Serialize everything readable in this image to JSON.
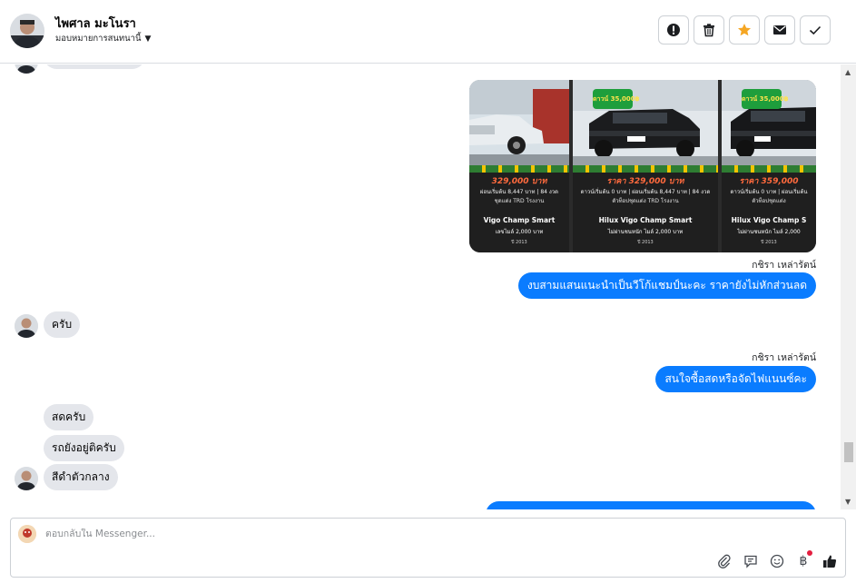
{
  "header": {
    "contact_name": "ไพศาล มะโนรา",
    "assign_label": "มอบหมายการสนทนานี้"
  },
  "messages": {
    "out_1": "งบสามแสนแนะนำเป็นวีโก้แชมป์นะคะ ราคายังไม่หักส่วนลด",
    "in_1": "ครับ",
    "out_2": "สนใจซื้อสดหรือจัดไฟแนนซ์คะ",
    "in_2": "สดครับ",
    "in_3": "รถยังอยู่ติครับ",
    "in_4": "สีดำตัวกลาง",
    "sender_1": "กชิรา เหล่ารัตน์",
    "sender_2": "กชิรา เหล่ารัตน์"
  },
  "attachment": {
    "cards": [
      {
        "badge": "",
        "price": "329,000 บาท",
        "detail": "ผ่อนเริ่มต้น 8,447 บาท | 84 งวด",
        "detail2": "ชุดแต่ง TRD โรงงาน",
        "model": "Vigo Champ Smart",
        "note": "เลขไมล์ 2,000 บาท",
        "meta": "ปี 2013",
        "strip": "CKCZCAR CKCZCAR CK"
      },
      {
        "badge": "ดาวน์ 35,000฿",
        "price": "ราคา 329,000 บาท",
        "detail": "ดาวน์เริ่มต้น 0 บาท | ผ่อนเริ่มต้น 8,447 บาท | 84 งวด",
        "detail2": "ตัวท็อปชุดแต่ง TRD โรงงาน",
        "model": "Hilux Vigo Champ Smart",
        "note": "ไม่ผ่านชนหนัก ไมล์ 2,000 บาท",
        "meta": "ปี 2013",
        "strip": "CKCZCAR CKCZCAR CK"
      },
      {
        "badge": "ดาวน์ 35,000฿",
        "price": "ราคา 359,000",
        "detail": "ดาวน์เริ่มต้น 0 บาท | ผ่อนเริ่มต้น",
        "detail2": "ตัวท็อปชุดแต่ง",
        "model": "Hilux Vigo Champ S",
        "note": "ไม่ผ่านชนหนัก ไมล์ 2,000",
        "meta": "ปี 2013",
        "strip": "CKCZCAR CKCZCAR CK"
      }
    ]
  },
  "composer": {
    "placeholder": "ตอบกลับใน Messenger..."
  },
  "colors": {
    "outgoing_bubble": "#0a7cff",
    "incoming_bubble": "#e4e6eb",
    "star_icon": "#f5a623",
    "notification_dot": "#e41e3f"
  },
  "icons": [
    "alert-icon",
    "trash-icon",
    "star-icon",
    "mail-icon",
    "check-icon",
    "attach-icon",
    "saved-replies-icon",
    "emoji-icon",
    "baht-icon",
    "like-icon"
  ]
}
